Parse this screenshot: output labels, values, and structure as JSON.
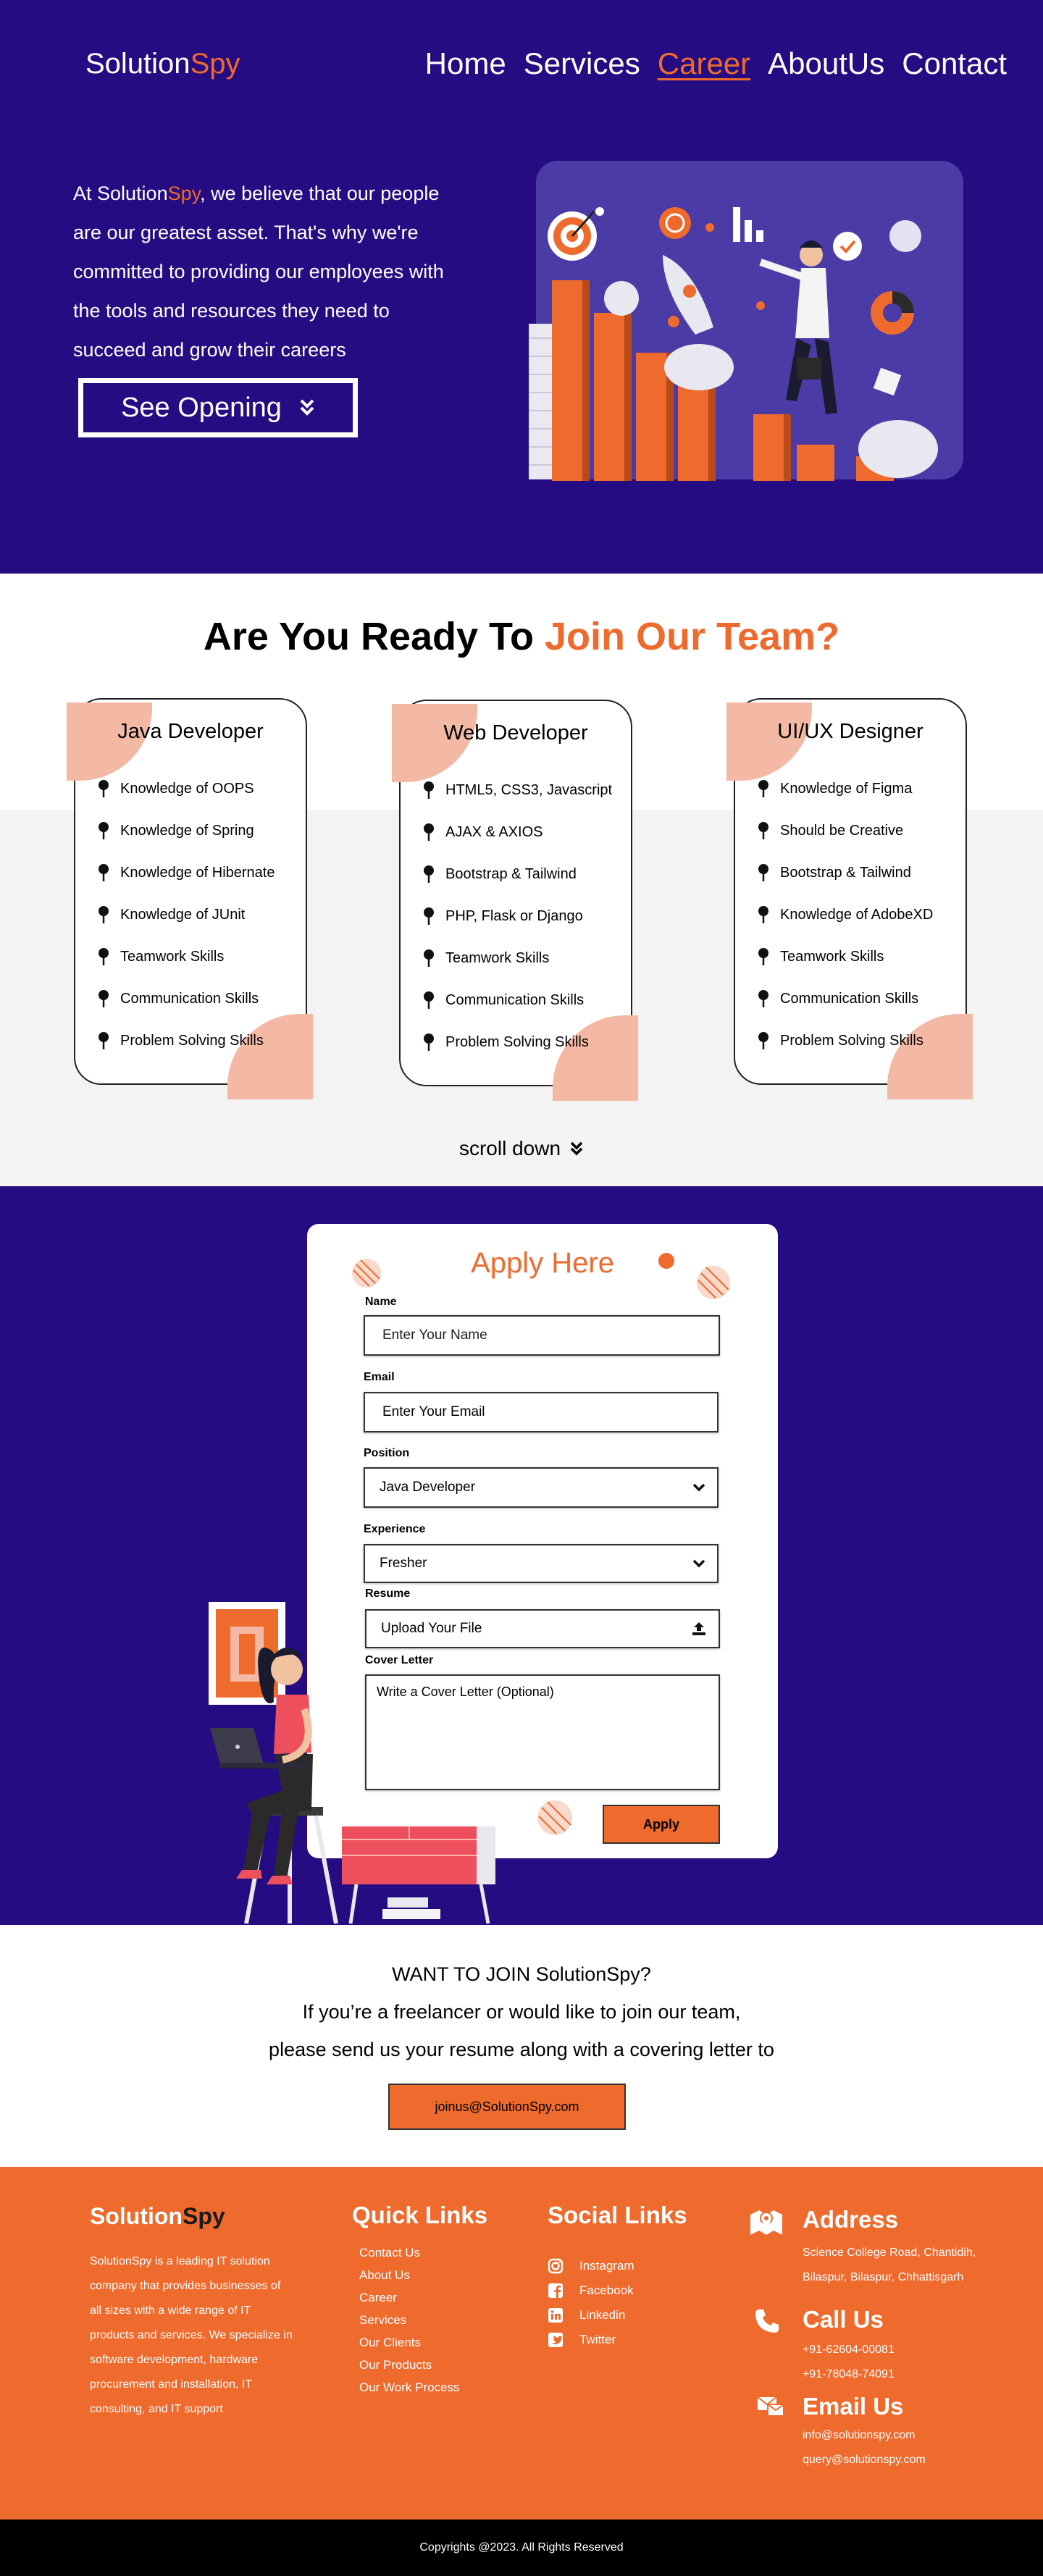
{
  "header": {
    "logo_part1": "Solution",
    "logo_part2": "Spy",
    "nav": [
      "Home",
      "Services",
      "Career",
      "AboutUs",
      "Contact"
    ],
    "active_nav": "Career"
  },
  "hero": {
    "text_pre": "At Solution",
    "text_highlight": "Spy",
    "text_post": ", we believe that our people are our greatest asset. That's why we're committed to providing our employees with the tools and resources they need to succeed and grow their careers",
    "button_label": "See Opening"
  },
  "team": {
    "title_part1": "Are You Ready To ",
    "title_part2": "Join Our Team?",
    "cards": [
      {
        "title": "Java Developer",
        "items": [
          "Knowledge of OOPS",
          "Knowledge of Spring",
          "Knowledge of Hibernate",
          "Knowledge of JUnit",
          "Teamwork Skills",
          "Communication Skills",
          "Problem Solving Skills"
        ]
      },
      {
        "title": "Web Developer",
        "items": [
          "HTML5, CSS3, Javascript",
          "AJAX & AXIOS",
          "Bootstrap & Tailwind",
          "PHP, Flask or Django",
          "Teamwork Skills",
          "Communication Skills",
          "Problem Solving Skills"
        ]
      },
      {
        "title": "UI/UX Designer",
        "items": [
          "Knowledge of Figma",
          "Should be Creative",
          "Bootstrap & Tailwind",
          "Knowledge of AdobeXD",
          "Teamwork Skills",
          "Communication Skills",
          "Problem Solving Skills"
        ]
      }
    ],
    "scroll_label": "scroll down"
  },
  "apply": {
    "title": "Apply Here",
    "name_label": "Name",
    "name_placeholder": "Enter Your Name",
    "email_label": "Email",
    "email_placeholder": "Enter Your Email",
    "position_label": "Position",
    "position_value": "Java Developer",
    "experience_label": "Experience",
    "experience_value": "Fresher",
    "resume_label": "Resume",
    "resume_placeholder": "Upload Your File",
    "cover_label": "Cover Letter",
    "cover_placeholder": "Write a Cover Letter (Optional)",
    "button_label": "Apply"
  },
  "join": {
    "line1": "WANT TO JOIN SolutionSpy?",
    "line2": "If you’re a freelancer or would like to join our team,",
    "line3": "please send us your resume along with a covering letter to",
    "email": "joinus@SolutionSpy.com"
  },
  "footer": {
    "logo_part1": "Solution",
    "logo_part2": "Spy",
    "about": "SolutionSpy is a leading IT solution company that provides businesses of all sizes with a wide range of IT products and services. We specialize in software development, hardware procurement and installation, IT consulting, and IT support",
    "quick_links_title": "Quick Links",
    "quick_links": [
      "Contact Us",
      "About Us",
      "Career",
      "Services",
      "Our Clients",
      "Our Products",
      "Our Work Process"
    ],
    "social_title": "Social Links",
    "social": [
      {
        "label": "Instagram",
        "icon": "instagram-icon"
      },
      {
        "label": "Facebook",
        "icon": "facebook-icon"
      },
      {
        "label": "Linkedin",
        "icon": "linkedin-icon"
      },
      {
        "label": "Twitter",
        "icon": "twitter-icon"
      }
    ],
    "address_title": "Address",
    "address": "Science College Road, Chantidih, Bilaspur, Bilaspur, Chhattisgarh",
    "call_title": "Call Us",
    "phones": [
      "+91-62604-00081",
      "+91-78048-74091"
    ],
    "email_title": "Email Us",
    "emails": [
      "info@solutionspy.com",
      "query@solutionspy.com"
    ],
    "copyright": "Copyrights @2023. All Rights Reserved"
  },
  "colors": {
    "primary": "#260c82",
    "accent": "#ee6a2d",
    "peach": "#f3b9a4",
    "light_band": "#f3f3f3"
  }
}
